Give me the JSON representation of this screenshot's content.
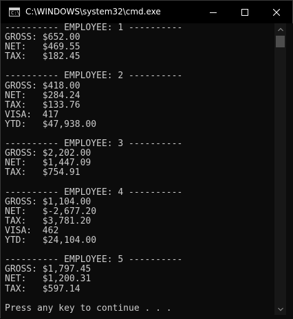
{
  "window": {
    "title": "C:\\WINDOWS\\system32\\cmd.exe",
    "icon": "cmd-icon",
    "icon_glyph": "C:\\",
    "controls": [
      "minimize-icon",
      "maximize-icon",
      "close-icon"
    ]
  },
  "console": {
    "lines": [
      "---------- EMPLOYEE: 1 ----------",
      "GROSS: $652.00",
      "NET:   $469.55",
      "TAX:   $182.45",
      "",
      "---------- EMPLOYEE: 2 ----------",
      "GROSS: $418.00",
      "NET:   $284.24",
      "TAX:   $133.76",
      "VISA:  417",
      "YTD:   $47,938.00",
      "",
      "---------- EMPLOYEE: 3 ----------",
      "GROSS: $2,202.00",
      "NET:   $1,447.09",
      "TAX:   $754.91",
      "",
      "---------- EMPLOYEE: 4 ----------",
      "GROSS: $1,104.00",
      "NET:   $-2,677.20",
      "TAX:   $3,781.20",
      "VISA:  462",
      "YTD:   $24,104.00",
      "",
      "---------- EMPLOYEE: 5 ----------",
      "GROSS: $1,797.45",
      "NET:   $1,200.31",
      "TAX:   $597.14",
      "",
      "Press any key to continue . . ."
    ]
  },
  "colors": {
    "background": "#0c0c0c",
    "text": "#cccccc",
    "titlebar": "#000000",
    "scrollbar_thumb": "#4d4d4d"
  }
}
